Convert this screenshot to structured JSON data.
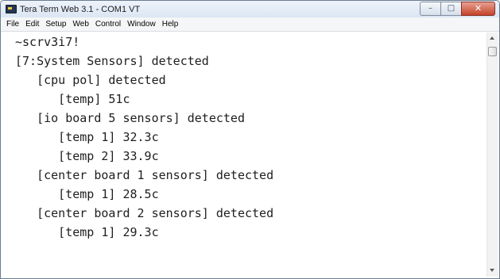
{
  "window": {
    "title": "Tera Term Web 3.1 - COM1 VT",
    "buttons": {
      "minimize": "–",
      "maximize": "□",
      "close": "✕"
    }
  },
  "menu": [
    "File",
    "Edit",
    "Setup",
    "Web",
    "Control",
    "Window",
    "Help"
  ],
  "terminal": {
    "lines": [
      "~scrv3i7!",
      "[7:System Sensors] detected",
      "   [cpu pol] detected",
      "      [temp] 51c",
      "   [io board 5 sensors] detected",
      "      [temp 1] 32.3c",
      "      [temp 2] 33.9c",
      "   [center board 1 sensors] detected",
      "      [temp 1] 28.5c",
      "   [center board 2 sensors] detected",
      "      [temp 1] 29.3c"
    ]
  },
  "icons": {
    "app": "tera-term-icon",
    "scroll_up": "arrow-up-icon",
    "scroll_down": "arrow-down-icon"
  }
}
